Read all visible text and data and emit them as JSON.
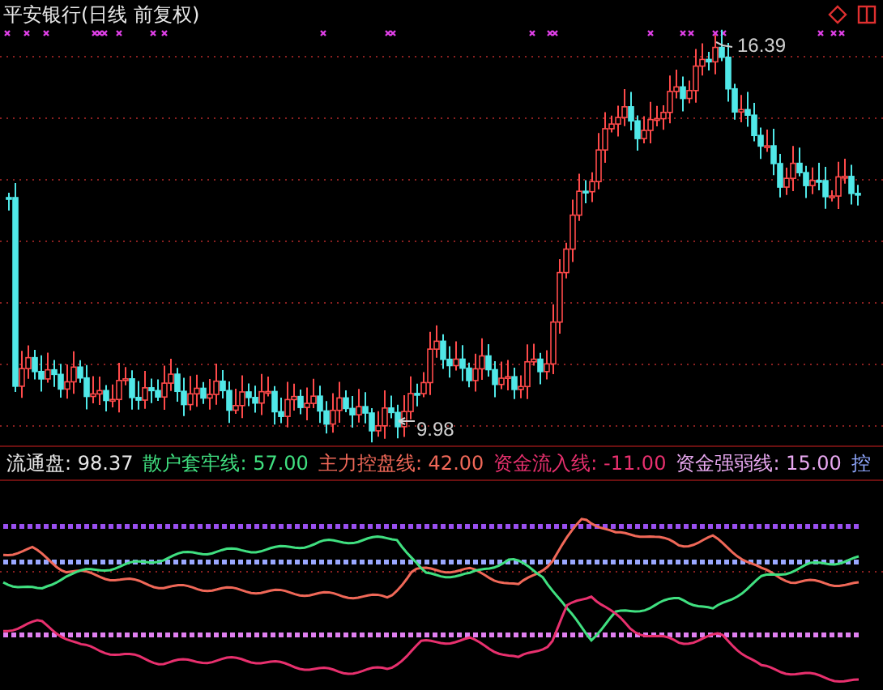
{
  "title": "平安银行(日线 前复权)",
  "price_labels": {
    "high": "16.39",
    "low": "9.98"
  },
  "legend": [
    {
      "text": "流通盘: 98.37",
      "color": "#e8e8e8"
    },
    {
      "text": "散户套牢线: 57.00",
      "color": "#40e080"
    },
    {
      "text": "主力控盘线: 42.00",
      "color": "#f06858"
    },
    {
      "text": "资金流入线: -11.00",
      "color": "#e8306e"
    },
    {
      "text": "资金强弱线: 15.00",
      "color": "#e8a8f0"
    },
    {
      "text": "控",
      "color": "#90a8ff"
    }
  ]
}
